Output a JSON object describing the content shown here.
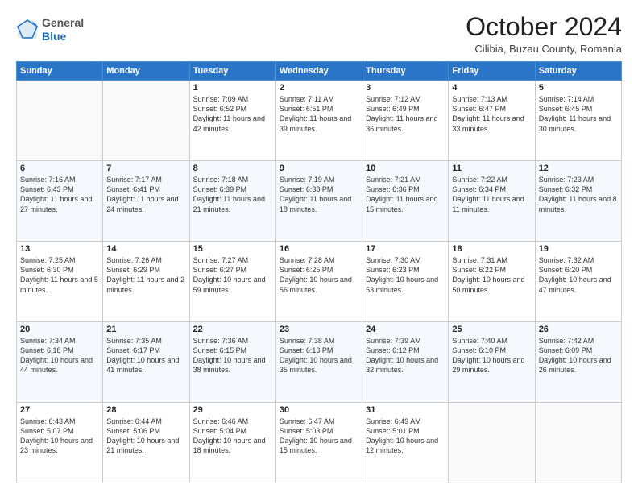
{
  "header": {
    "logo": {
      "general": "General",
      "blue": "Blue"
    },
    "title": "October 2024",
    "location": "Cilibia, Buzau County, Romania"
  },
  "days_of_week": [
    "Sunday",
    "Monday",
    "Tuesday",
    "Wednesday",
    "Thursday",
    "Friday",
    "Saturday"
  ],
  "weeks": [
    [
      {
        "day": "",
        "info": ""
      },
      {
        "day": "",
        "info": ""
      },
      {
        "day": "1",
        "info": "Sunrise: 7:09 AM\nSunset: 6:52 PM\nDaylight: 11 hours and 42 minutes."
      },
      {
        "day": "2",
        "info": "Sunrise: 7:11 AM\nSunset: 6:51 PM\nDaylight: 11 hours and 39 minutes."
      },
      {
        "day": "3",
        "info": "Sunrise: 7:12 AM\nSunset: 6:49 PM\nDaylight: 11 hours and 36 minutes."
      },
      {
        "day": "4",
        "info": "Sunrise: 7:13 AM\nSunset: 6:47 PM\nDaylight: 11 hours and 33 minutes."
      },
      {
        "day": "5",
        "info": "Sunrise: 7:14 AM\nSunset: 6:45 PM\nDaylight: 11 hours and 30 minutes."
      }
    ],
    [
      {
        "day": "6",
        "info": "Sunrise: 7:16 AM\nSunset: 6:43 PM\nDaylight: 11 hours and 27 minutes."
      },
      {
        "day": "7",
        "info": "Sunrise: 7:17 AM\nSunset: 6:41 PM\nDaylight: 11 hours and 24 minutes."
      },
      {
        "day": "8",
        "info": "Sunrise: 7:18 AM\nSunset: 6:39 PM\nDaylight: 11 hours and 21 minutes."
      },
      {
        "day": "9",
        "info": "Sunrise: 7:19 AM\nSunset: 6:38 PM\nDaylight: 11 hours and 18 minutes."
      },
      {
        "day": "10",
        "info": "Sunrise: 7:21 AM\nSunset: 6:36 PM\nDaylight: 11 hours and 15 minutes."
      },
      {
        "day": "11",
        "info": "Sunrise: 7:22 AM\nSunset: 6:34 PM\nDaylight: 11 hours and 11 minutes."
      },
      {
        "day": "12",
        "info": "Sunrise: 7:23 AM\nSunset: 6:32 PM\nDaylight: 11 hours and 8 minutes."
      }
    ],
    [
      {
        "day": "13",
        "info": "Sunrise: 7:25 AM\nSunset: 6:30 PM\nDaylight: 11 hours and 5 minutes."
      },
      {
        "day": "14",
        "info": "Sunrise: 7:26 AM\nSunset: 6:29 PM\nDaylight: 11 hours and 2 minutes."
      },
      {
        "day": "15",
        "info": "Sunrise: 7:27 AM\nSunset: 6:27 PM\nDaylight: 10 hours and 59 minutes."
      },
      {
        "day": "16",
        "info": "Sunrise: 7:28 AM\nSunset: 6:25 PM\nDaylight: 10 hours and 56 minutes."
      },
      {
        "day": "17",
        "info": "Sunrise: 7:30 AM\nSunset: 6:23 PM\nDaylight: 10 hours and 53 minutes."
      },
      {
        "day": "18",
        "info": "Sunrise: 7:31 AM\nSunset: 6:22 PM\nDaylight: 10 hours and 50 minutes."
      },
      {
        "day": "19",
        "info": "Sunrise: 7:32 AM\nSunset: 6:20 PM\nDaylight: 10 hours and 47 minutes."
      }
    ],
    [
      {
        "day": "20",
        "info": "Sunrise: 7:34 AM\nSunset: 6:18 PM\nDaylight: 10 hours and 44 minutes."
      },
      {
        "day": "21",
        "info": "Sunrise: 7:35 AM\nSunset: 6:17 PM\nDaylight: 10 hours and 41 minutes."
      },
      {
        "day": "22",
        "info": "Sunrise: 7:36 AM\nSunset: 6:15 PM\nDaylight: 10 hours and 38 minutes."
      },
      {
        "day": "23",
        "info": "Sunrise: 7:38 AM\nSunset: 6:13 PM\nDaylight: 10 hours and 35 minutes."
      },
      {
        "day": "24",
        "info": "Sunrise: 7:39 AM\nSunset: 6:12 PM\nDaylight: 10 hours and 32 minutes."
      },
      {
        "day": "25",
        "info": "Sunrise: 7:40 AM\nSunset: 6:10 PM\nDaylight: 10 hours and 29 minutes."
      },
      {
        "day": "26",
        "info": "Sunrise: 7:42 AM\nSunset: 6:09 PM\nDaylight: 10 hours and 26 minutes."
      }
    ],
    [
      {
        "day": "27",
        "info": "Sunrise: 6:43 AM\nSunset: 5:07 PM\nDaylight: 10 hours and 23 minutes."
      },
      {
        "day": "28",
        "info": "Sunrise: 6:44 AM\nSunset: 5:06 PM\nDaylight: 10 hours and 21 minutes."
      },
      {
        "day": "29",
        "info": "Sunrise: 6:46 AM\nSunset: 5:04 PM\nDaylight: 10 hours and 18 minutes."
      },
      {
        "day": "30",
        "info": "Sunrise: 6:47 AM\nSunset: 5:03 PM\nDaylight: 10 hours and 15 minutes."
      },
      {
        "day": "31",
        "info": "Sunrise: 6:49 AM\nSunset: 5:01 PM\nDaylight: 10 hours and 12 minutes."
      },
      {
        "day": "",
        "info": ""
      },
      {
        "day": "",
        "info": ""
      }
    ]
  ]
}
